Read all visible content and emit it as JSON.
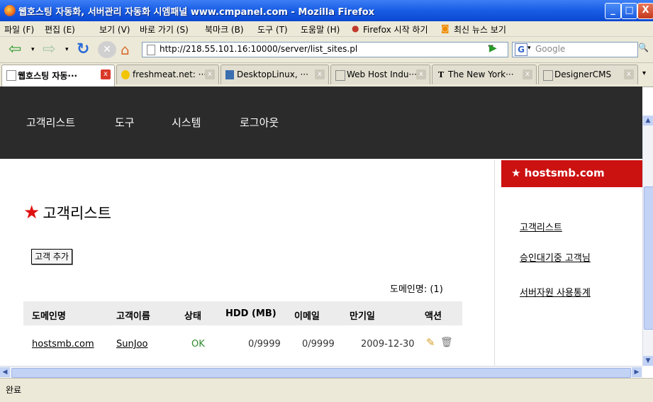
{
  "window": {
    "title": "웹호스팅 자동화, 서버관리 자동화 시엠패널 www.cmpanel.com - Mozilla Firefox",
    "controls": [
      "_",
      "□",
      "X"
    ]
  },
  "menubar": {
    "items": [
      "파일 (F)",
      "편집 (E)",
      "보기 (V)",
      "바로 가기 (S)",
      "북마크 (B)",
      "도구 (T)",
      "도움말 (H)"
    ],
    "bookmarks": [
      "Firefox 시작 하기",
      "최신 뉴스 보기"
    ]
  },
  "toolbar": {
    "url": "http://218.55.101.16:10000/server/list_sites.pl",
    "search_placeholder": "Google",
    "search_engine_letter": "G"
  },
  "tabs": [
    {
      "label": "웹호스팅 자동···",
      "active": true
    },
    {
      "label": "freshmeat.net: ···",
      "active": false
    },
    {
      "label": "DesktopLinux, ···",
      "active": false
    },
    {
      "label": "Web Host Indu···",
      "active": false
    },
    {
      "label": "The New York···",
      "active": false
    },
    {
      "label": "DesignerCMS",
      "active": false
    }
  ],
  "site_nav": [
    "고객리스트",
    "도구",
    "시스템",
    "로그아웃"
  ],
  "sidebar": {
    "brand": "★ hostsmb.com",
    "links": [
      "고객리스트",
      "승인대기중 고객님",
      "서버자원 사용통계"
    ]
  },
  "main": {
    "title": "고객리스트",
    "add_button": "고객 추가",
    "domain_count": "도메인명: (1)",
    "columns": [
      "도메인명",
      "고객이름",
      "상태",
      "HDD (MB)",
      "이메일",
      "만기일",
      "액션"
    ],
    "rows": [
      {
        "domain": "hostsmb.com",
        "name": "SunJoo",
        "status": "OK",
        "hdd": "0/9999",
        "email": "0/9999",
        "expiry": "2009-12-30"
      }
    ]
  },
  "statusbar": {
    "text": "완료"
  },
  "colors": {
    "brand_red": "#cc1111",
    "nav_dark": "#2b2b2b",
    "ok_green": "#2d8a2d",
    "titlebar_blue": "#1b5fe6"
  }
}
